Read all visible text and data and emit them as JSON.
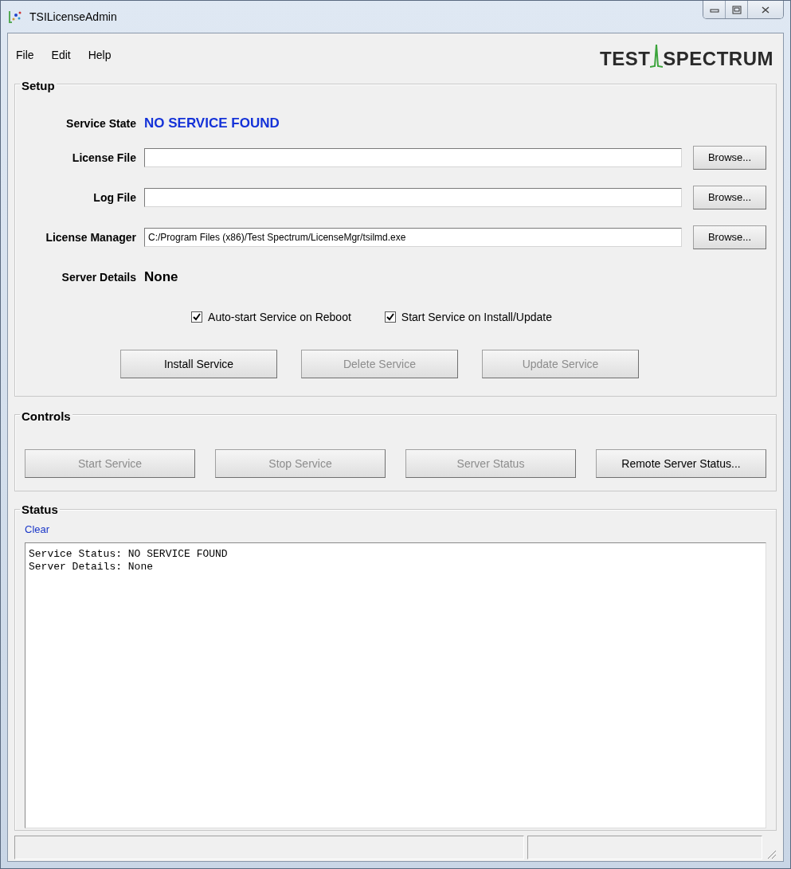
{
  "window": {
    "title": "TSILicenseAdmin"
  },
  "menu": [
    {
      "label": "File"
    },
    {
      "label": "Edit"
    },
    {
      "label": "Help"
    }
  ],
  "logo": {
    "left": "TEST",
    "right": "SPECTRUM"
  },
  "setup": {
    "title": "Setup",
    "service_state": {
      "label": "Service State",
      "value": "NO SERVICE FOUND"
    },
    "fields": [
      {
        "label": "License File",
        "button": "Browse..."
      },
      {
        "label": "Log File",
        "button": "Browse..."
      },
      {
        "label": "License Manager",
        "value": "C:/Program Files (x86)/Test Spectrum/LicenseMgr/tsilmd.exe",
        "button": "Browse..."
      }
    ],
    "server_details": {
      "label": "Server Details",
      "value": "None"
    },
    "options": [
      {
        "label": "Auto-start Service on Reboot",
        "checked": true
      },
      {
        "label": "Start Service on Install/Update",
        "checked": true
      }
    ],
    "buttons": [
      {
        "label": "Install Service",
        "disabled": false
      },
      {
        "label": "Delete Service",
        "disabled": true
      },
      {
        "label": "Update Service",
        "disabled": true
      }
    ]
  },
  "controls": {
    "title": "Controls",
    "buttons": [
      {
        "label": "Start Service",
        "disabled": true
      },
      {
        "label": "Stop Service",
        "disabled": true
      },
      {
        "label": "Server Status",
        "disabled": true
      },
      {
        "label": "Remote Server Status...",
        "disabled": false
      }
    ]
  },
  "status": {
    "title": "Status",
    "clear": "Clear",
    "log": [
      "Service Status: NO SERVICE FOUND",
      "Server Details: None"
    ]
  }
}
